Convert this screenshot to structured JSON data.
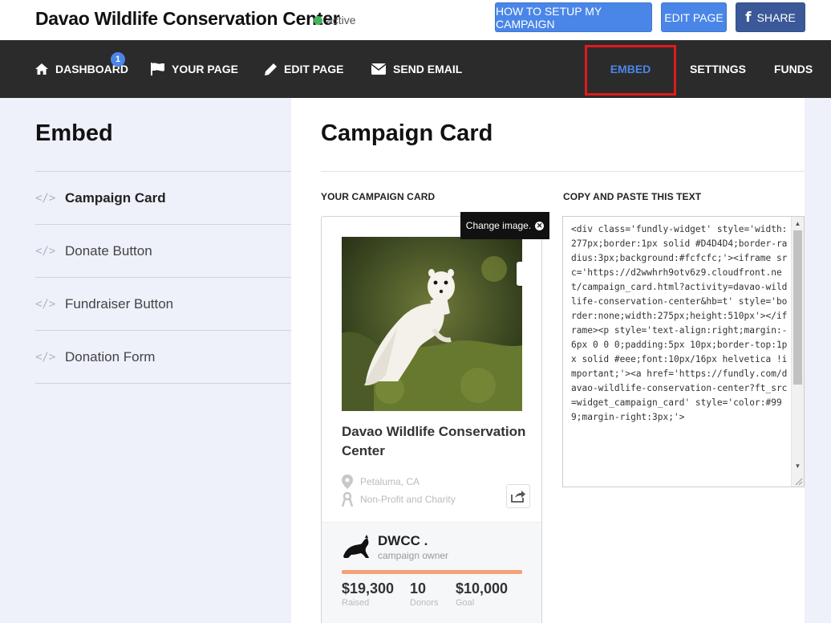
{
  "header": {
    "org_title": "Davao Wildlife Conservation Center",
    "status": "active",
    "status_color": "#44b35a",
    "buttons": {
      "howto": "HOW TO SETUP MY CAMPAIGN",
      "edit_page": "EDIT PAGE",
      "share": "SHARE",
      "share_icon": "facebook-icon"
    }
  },
  "nav": {
    "dashboard": "DASHBOARD",
    "dashboard_badge": "1",
    "your_page": "YOUR PAGE",
    "edit_page": "EDIT PAGE",
    "send_email": "SEND EMAIL",
    "embed": "EMBED",
    "settings": "SETTINGS",
    "funds": "FUNDS",
    "active_item": "EMBED",
    "highlight_color": "#e01b1b"
  },
  "sidebar": {
    "title": "Embed",
    "items": [
      {
        "label": "Campaign Card",
        "icon": "code-icon",
        "active": true
      },
      {
        "label": "Donate Button",
        "icon": "code-icon",
        "active": false
      },
      {
        "label": "Fundraiser Button",
        "icon": "code-icon",
        "active": false
      },
      {
        "label": "Donation Form",
        "icon": "code-icon",
        "active": false
      }
    ]
  },
  "main": {
    "title": "Campaign Card",
    "your_card_label": "YOUR CAMPAIGN CARD",
    "copy_label": "COPY AND PASTE THIS TEXT",
    "tooltip": "Change image.",
    "embed_code": "<div class='fundly-widget' style='width:277px;border:1px solid #D4D4D4;border-radius:3px;background:#fcfcfc;'><iframe src='https://d2wwhrh9otv6z9.cloudfront.net/campaign_card.html?activity=davao-wildlife-conservation-center&hb=t' style='border:none;width:275px;height:510px'></iframe><p style='text-align:right;margin:-6px 0 0 0;padding:5px 10px;border-top:1px solid #eee;font:10px/16px helvetica !important;'><a href='https://fundly.com/davao-wildlife-conservation-center?ft_src=widget_campaign_card' style='color:#999;margin-right:3px;'>"
  },
  "card": {
    "name": "Davao Wildlife Conservation Center",
    "location": "Petaluma, CA",
    "category": "Non-Profit and Charity",
    "owner_name": "DWCC .",
    "owner_role": "campaign owner",
    "progress_fraction": 1.0,
    "progress_color": "#f4a07a",
    "stats": {
      "raised_value": "$19,300",
      "raised_label": "Raised",
      "donors_value": "10",
      "donors_label": "Donors",
      "goal_value": "$10,000",
      "goal_label": "Goal"
    }
  },
  "colors": {
    "primary_blue": "#4a86e8",
    "facebook_blue": "#3b5998",
    "nav_bg": "#2b2b2b",
    "sidebar_bg": "#eef0fa"
  }
}
